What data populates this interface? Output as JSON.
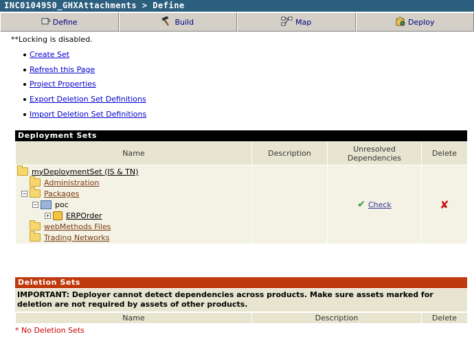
{
  "header": {
    "title": "INC0104950_GHXAttachments > Define"
  },
  "tabs": [
    {
      "label": "Define",
      "icon": "define-icon"
    },
    {
      "label": "Build",
      "icon": "hammer-icon"
    },
    {
      "label": "Map",
      "icon": "map-icon"
    },
    {
      "label": "Deploy",
      "icon": "deploy-icon"
    }
  ],
  "locking_note": "**Locking is disabled.",
  "links": [
    "Create Set",
    "Refresh this Page",
    "Project Properties",
    "Export Deletion Set Definitions",
    "Import Deletion Set Definitions"
  ],
  "deployment_sets": {
    "title": "Deployment Sets",
    "header_color": "#000000",
    "columns": {
      "name": "Name",
      "description": "Description",
      "unresolved": "Unresolved Dependencies",
      "delete": "Delete"
    },
    "tree": {
      "root": "myDeploymentSet (IS & TN)",
      "administration": "Administration",
      "packages": "Packages",
      "poc": "poc",
      "erporder": "ERPOrder",
      "webmethods_files": "webMethods Files",
      "trading_networks": "Trading Networks"
    },
    "check_label": "Check",
    "check_icon": "checkmark-icon",
    "delete_icon": "delete-x-icon"
  },
  "deletion_sets": {
    "title": "Deletion Sets",
    "header_color": "#c03a10",
    "important": "IMPORTANT: Deployer cannot detect dependencies across products. Make sure assets marked for deletion are not required by assets of other products.",
    "columns": {
      "name": "Name",
      "description": "Description",
      "delete": "Delete"
    },
    "empty": "* No Deletion Sets"
  }
}
